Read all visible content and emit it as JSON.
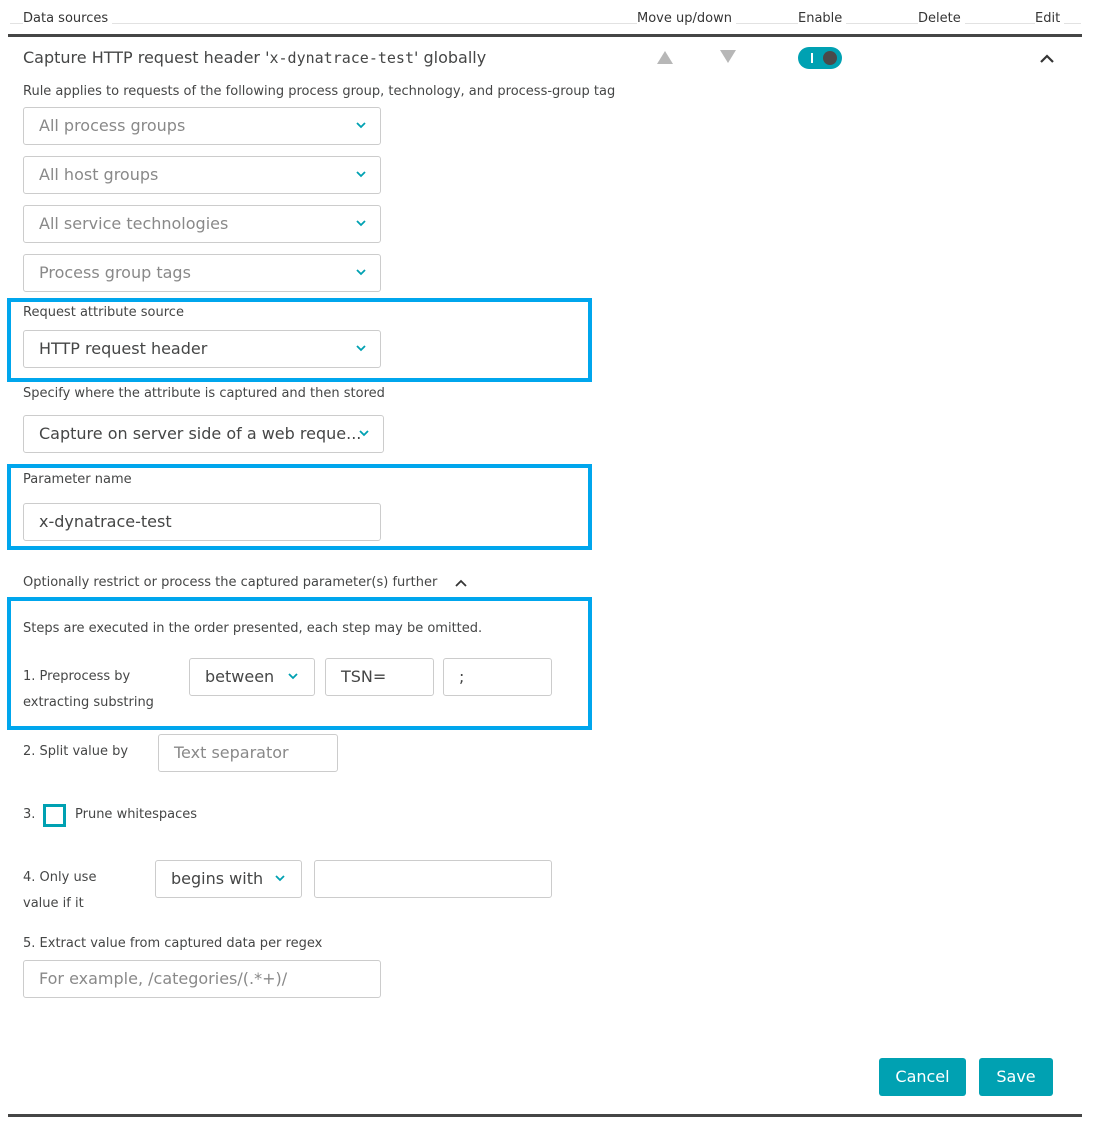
{
  "header": {
    "columns": {
      "data_sources": "Data sources",
      "move": "Move up/down",
      "enable": "Enable",
      "delete": "Delete",
      "edit": "Edit"
    }
  },
  "rule": {
    "title_prefix": "Capture HTTP request header '",
    "title_code": "x-dynatrace-test",
    "title_suffix": "' globally",
    "enabled": true,
    "scope_label": "Rule applies to requests of the following process group, technology, and process-group tag",
    "scope_selects": [
      {
        "value": "All process groups"
      },
      {
        "value": "All host groups"
      },
      {
        "value": "All service technologies"
      },
      {
        "value": "Process group tags"
      }
    ],
    "source_label": "Request attribute source",
    "source_value": "HTTP request header",
    "capture_label": "Specify where the attribute is captured and then stored",
    "capture_value": "Capture on server side of a web reque...",
    "param_label": "Parameter name",
    "param_value": "x-dynatrace-test",
    "optional_label": "Optionally restrict or process the captured parameter(s) further",
    "steps_intro": "Steps are executed in the order presented, each step may be omitted.",
    "step1": {
      "label_line1": "1. Preprocess by",
      "label_line2": "extracting substring",
      "mode": "between",
      "from": "TSN=",
      "to": ";"
    },
    "step2": {
      "label": "2. Split value by",
      "placeholder": "Text separator"
    },
    "step3": {
      "number": "3.",
      "label": "Prune whitespaces",
      "checked": false
    },
    "step4": {
      "label_line1": "4. Only use",
      "label_line2": "value if it",
      "mode": "begins with",
      "value": ""
    },
    "step5": {
      "label": "5. Extract value from captured data per regex",
      "placeholder": "For example, /categories/(.*+)/"
    }
  },
  "actions": {
    "cancel": "Cancel",
    "save": "Save"
  },
  "colors": {
    "accent": "#00a1b2",
    "highlight": "#00a6ed",
    "text": "#454646"
  }
}
